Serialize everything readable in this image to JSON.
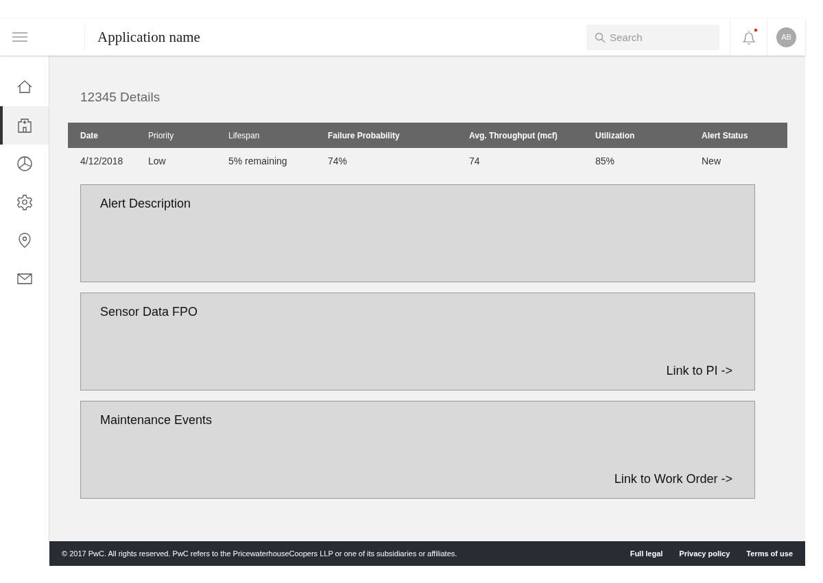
{
  "header": {
    "app_name": "Application name",
    "search": {
      "placeholder": "Search"
    },
    "notifications": {
      "unread": true
    },
    "avatar": "AB"
  },
  "sidebar": {
    "items": [
      {
        "kind": "home",
        "selected": false
      },
      {
        "kind": "building",
        "selected": true
      },
      {
        "kind": "chart",
        "selected": false
      },
      {
        "kind": "settings",
        "selected": false
      },
      {
        "kind": "location",
        "selected": false
      },
      {
        "kind": "mail",
        "selected": false
      }
    ]
  },
  "page_title": "12345 Details",
  "table": {
    "columns": [
      {
        "label": "Date",
        "bold": true
      },
      {
        "label": "Priority",
        "bold": false
      },
      {
        "label": "Lifespan",
        "bold": false
      },
      {
        "label": "Failure Probability",
        "bold": true
      },
      {
        "label": "Avg. Throughput (mcf)",
        "bold": true
      },
      {
        "label": "Utilization",
        "bold": true
      },
      {
        "label": "Alert Status",
        "bold": true
      }
    ],
    "rows": [
      [
        "4/12/2018",
        "Low",
        "5% remaining",
        "74%",
        "74",
        "85%",
        "New"
      ]
    ]
  },
  "panels": [
    {
      "title": "Alert Description"
    },
    {
      "title": "Sensor Data FPO",
      "link": "Link to PI ->"
    },
    {
      "title": "Maintenance Events",
      "link": "Link to Work Order ->"
    }
  ],
  "footer": {
    "copyright": "© 2017 PwC. All rights reserved. PwC refers to the PricewaterhouseCoopers LLP or one of its subsidiaries or affiliates.",
    "links": [
      "Full legal",
      "Privacy policy",
      "Terms of use"
    ]
  }
}
